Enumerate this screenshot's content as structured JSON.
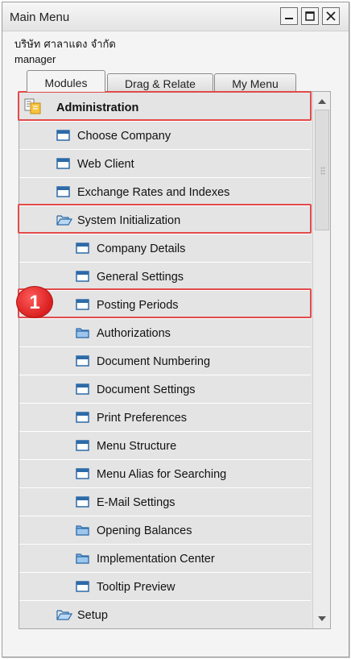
{
  "window": {
    "title": "Main Menu",
    "company": "บริษัท ศาลาแดง จำกัด",
    "user": "manager"
  },
  "tabs": [
    {
      "label": "Modules",
      "active": true
    },
    {
      "label": "Drag & Relate",
      "active": false
    },
    {
      "label": "My Menu",
      "active": false
    }
  ],
  "menu": {
    "items": [
      {
        "label": "Administration",
        "icon": "module-document-icon",
        "level": 0,
        "bold": true,
        "highlighted": true
      },
      {
        "label": "Choose Company",
        "icon": "window-form-icon",
        "level": 1
      },
      {
        "label": "Web Client",
        "icon": "window-form-icon",
        "level": 1
      },
      {
        "label": "Exchange Rates and Indexes",
        "icon": "window-form-icon",
        "level": 1
      },
      {
        "label": "System Initialization",
        "icon": "folder-open-icon",
        "level": 1,
        "highlighted": true
      },
      {
        "label": "Company Details",
        "icon": "window-form-icon",
        "level": 2
      },
      {
        "label": "General Settings",
        "icon": "window-form-icon",
        "level": 2
      },
      {
        "label": "Posting Periods",
        "icon": "window-form-icon",
        "level": 2,
        "highlighted": true
      },
      {
        "label": "Authorizations",
        "icon": "folder-closed-icon",
        "level": 2
      },
      {
        "label": "Document Numbering",
        "icon": "window-form-icon",
        "level": 2
      },
      {
        "label": "Document Settings",
        "icon": "window-form-icon",
        "level": 2
      },
      {
        "label": "Print Preferences",
        "icon": "window-form-icon",
        "level": 2
      },
      {
        "label": "Menu Structure",
        "icon": "window-form-icon",
        "level": 2
      },
      {
        "label": "Menu Alias for Searching",
        "icon": "window-form-icon",
        "level": 2
      },
      {
        "label": "E-Mail Settings",
        "icon": "window-form-icon",
        "level": 2
      },
      {
        "label": "Opening Balances",
        "icon": "folder-closed-icon",
        "level": 2
      },
      {
        "label": "Implementation Center",
        "icon": "folder-closed-icon",
        "level": 2
      },
      {
        "label": "Tooltip Preview",
        "icon": "window-form-icon",
        "level": 2
      },
      {
        "label": "Setup",
        "icon": "folder-open-icon",
        "level": 1
      }
    ]
  },
  "annotation": {
    "step_number": "1"
  },
  "colors": {
    "highlight": "#e24a4a",
    "icon_blue": "#2d6aa8",
    "badge_red": "#d91f1f"
  }
}
